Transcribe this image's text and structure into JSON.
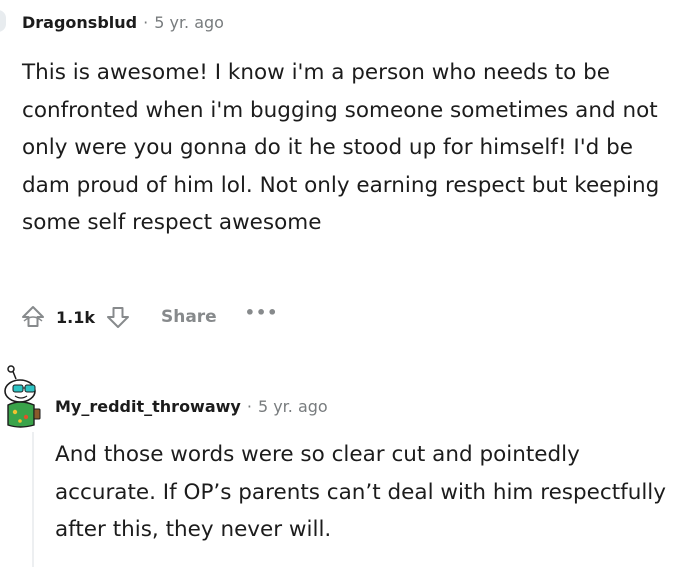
{
  "comments": [
    {
      "username": "Dragonsblud",
      "separator": "·",
      "time": "5 yr. ago",
      "body": "This is awesome! I know i'm a person who needs to be confronted when i'm bugging someone sometimes and not only were you gonna do it he stood up for himself! I'd be dam proud of him lol. Not only earning respect but keeping some self respect awesome",
      "votes": "1.1k",
      "share_label": "Share",
      "more_label": "•••",
      "icons": {
        "upvote": "upvote-icon",
        "downvote": "downvote-icon",
        "more": "more-options-icon"
      }
    },
    {
      "username": "My_reddit_throwawy",
      "separator": "·",
      "time": "5 yr. ago",
      "body": "And those words were so clear cut and pointedly accurate. If OP’s parents can’t deal with him respectfully after this, they never will.",
      "avatar": "snoo-avatar"
    }
  ],
  "colors": {
    "text": "#1c1c1c",
    "meta": "#787c7e",
    "action": "#878a8c",
    "thread_line": "#edeff1"
  }
}
